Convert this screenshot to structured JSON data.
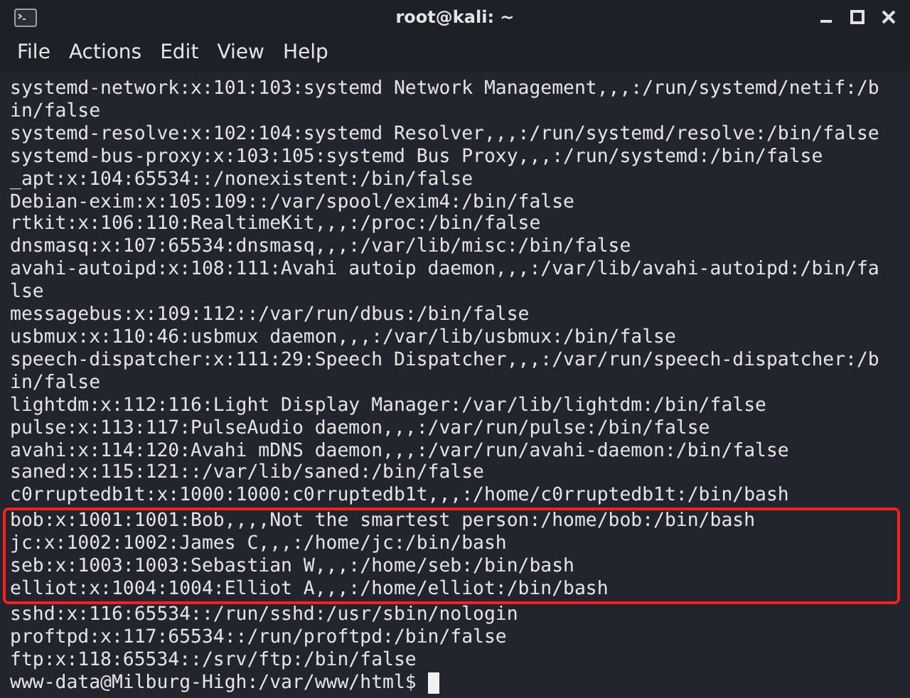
{
  "window": {
    "title": "root@kali: ~"
  },
  "menu": [
    "File",
    "Actions",
    "Edit",
    "View",
    "Help"
  ],
  "terminal": {
    "blocks": [
      {
        "highlighted": false,
        "lines": [
          "systemd-network:x:101:103:systemd Network Management,,,:/run/systemd/netif:/b",
          "in/false",
          "systemd-resolve:x:102:104:systemd Resolver,,,:/run/systemd/resolve:/bin/false",
          "systemd-bus-proxy:x:103:105:systemd Bus Proxy,,,:/run/systemd:/bin/false",
          "_apt:x:104:65534::/nonexistent:/bin/false",
          "Debian-exim:x:105:109::/var/spool/exim4:/bin/false",
          "rtkit:x:106:110:RealtimeKit,,,:/proc:/bin/false",
          "dnsmasq:x:107:65534:dnsmasq,,,:/var/lib/misc:/bin/false",
          "avahi-autoipd:x:108:111:Avahi autoip daemon,,,:/var/lib/avahi-autoipd:/bin/fa",
          "lse",
          "messagebus:x:109:112::/var/run/dbus:/bin/false",
          "usbmux:x:110:46:usbmux daemon,,,:/var/lib/usbmux:/bin/false",
          "speech-dispatcher:x:111:29:Speech Dispatcher,,,:/var/run/speech-dispatcher:/b",
          "in/false",
          "lightdm:x:112:116:Light Display Manager:/var/lib/lightdm:/bin/false",
          "pulse:x:113:117:PulseAudio daemon,,,:/var/run/pulse:/bin/false",
          "avahi:x:114:120:Avahi mDNS daemon,,,:/var/run/avahi-daemon:/bin/false",
          "saned:x:115:121::/var/lib/saned:/bin/false",
          "c0rruptedb1t:x:1000:1000:c0rruptedb1t,,,:/home/c0rruptedb1t:/bin/bash"
        ]
      },
      {
        "highlighted": true,
        "lines": [
          "bob:x:1001:1001:Bob,,,,Not the smartest person:/home/bob:/bin/bash",
          "jc:x:1002:1002:James C,,,:/home/jc:/bin/bash",
          "seb:x:1003:1003:Sebastian W,,,:/home/seb:/bin/bash",
          "elliot:x:1004:1004:Elliot A,,,:/home/elliot:/bin/bash"
        ]
      },
      {
        "highlighted": false,
        "lines": [
          "sshd:x:116:65534::/run/sshd:/usr/sbin/nologin",
          "proftpd:x:117:65534::/run/proftpd:/bin/false",
          "ftp:x:118:65534::/srv/ftp:/bin/false"
        ]
      }
    ],
    "prompt": "www-data@Milburg-High:/var/www/html$"
  }
}
